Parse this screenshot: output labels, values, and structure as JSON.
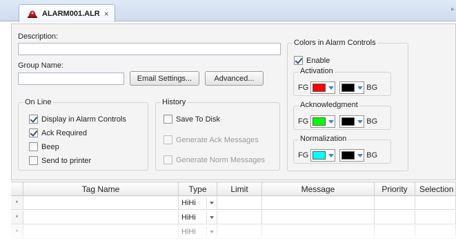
{
  "tab": {
    "title": "ALARM001.ALR",
    "close": "×"
  },
  "form": {
    "description_label": "Description:",
    "description_value": "",
    "group_name_label": "Group Name:",
    "group_name_value": "",
    "email_button": "Email Settings...",
    "advanced_button": "Advanced..."
  },
  "online": {
    "title": "On Line",
    "items": [
      {
        "label": "Display in Alarm Controls",
        "checked": true
      },
      {
        "label": "Ack Required",
        "checked": true
      },
      {
        "label": "Beep",
        "checked": false
      },
      {
        "label": "Send to printer",
        "checked": false
      }
    ]
  },
  "history": {
    "title": "History",
    "items": [
      {
        "label": "Save To Disk",
        "checked": false,
        "enabled": true
      },
      {
        "label": "Generate Ack Messages",
        "checked": false,
        "enabled": false
      },
      {
        "label": "Generate Norm Messages",
        "checked": false,
        "enabled": false
      }
    ]
  },
  "colors": {
    "title": "Colors in Alarm Controls",
    "enable_label": "Enable",
    "enable_checked": true,
    "fg": "FG",
    "bg": "BG",
    "groups": [
      {
        "title": "Activation",
        "fg_color": "#ff0000",
        "bg_color": "#000000"
      },
      {
        "title": "Acknowledgment",
        "fg_color": "#00ff00",
        "bg_color": "#000000"
      },
      {
        "title": "Normalization",
        "fg_color": "#00ffff",
        "bg_color": "#000000"
      }
    ]
  },
  "grid": {
    "columns": [
      "",
      "Tag Name",
      "Type",
      "Limit",
      "Message",
      "Priority",
      "Selection"
    ],
    "rows": [
      {
        "marker": "*",
        "tag": "",
        "type": "HiHi",
        "limit": "",
        "message": "",
        "priority": "",
        "selection": ""
      },
      {
        "marker": "*",
        "tag": "",
        "type": "HiHi",
        "limit": "",
        "message": "",
        "priority": "",
        "selection": ""
      },
      {
        "marker": "*",
        "tag": "",
        "type": "HiHi",
        "limit": "",
        "message": "",
        "priority": "",
        "selection": ""
      }
    ]
  }
}
